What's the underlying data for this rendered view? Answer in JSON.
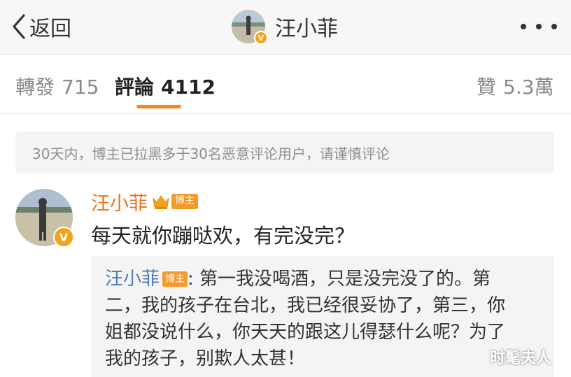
{
  "nav": {
    "back_label": "返回",
    "user_name": "汪小菲",
    "more_icon": "more-icon"
  },
  "tabs": [
    {
      "label": "轉發",
      "count": "715",
      "active": false
    },
    {
      "label": "評論",
      "count": "4112",
      "active": true
    },
    {
      "label": "贊",
      "count": "5.3萬",
      "active": false
    }
  ],
  "notice": "30天内，博主已拉黑多于30名恶意评论用户，请谨慎评论",
  "comment": {
    "user_name": "汪小菲",
    "badge": "博主",
    "text": "每天就你蹦哒欢，有完没完？",
    "reply": {
      "user_name": "汪小菲",
      "badge": "博主",
      "lines": [
        ": 第一我没喝酒，只是没完没了的。第",
        "二，我的孩子在台北，我已经很妥协了，第三，你",
        "姐都没说什么，你天天的跟这儿得瑟什么呢？为了",
        "我的孩子，别欺人太甚！"
      ]
    }
  },
  "watermark": "时髦夫人",
  "colors": {
    "accent": "#f38a1d",
    "commenter_name": "#e8731d",
    "reply_name": "#4c7bb6",
    "badge": "#f49a2b",
    "verified": "#f4a21c"
  }
}
